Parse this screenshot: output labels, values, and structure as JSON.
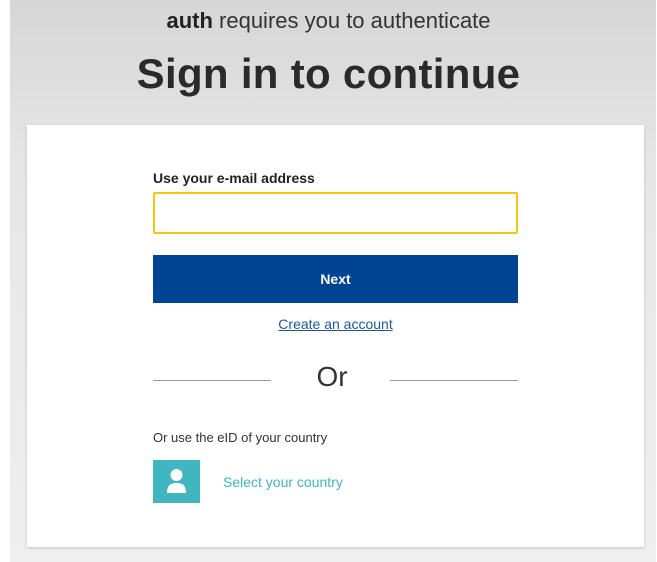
{
  "header": {
    "app_name": "auth",
    "subtitle_rest": " requires you to authenticate",
    "title": "Sign in to continue"
  },
  "login": {
    "email_label": "Use your e-mail address",
    "email_value": "",
    "next_label": "Next",
    "create_account_label": "Create an account",
    "or_label": "Or",
    "eid_label": "Or use the eID of your country",
    "select_country_label": "Select your country",
    "person_icon": "person-icon"
  },
  "colors": {
    "primary_button": "#004494",
    "input_focus_border": "#f2c80f",
    "link": "#1a5a9c",
    "eid_accent": "#40b6c0"
  }
}
